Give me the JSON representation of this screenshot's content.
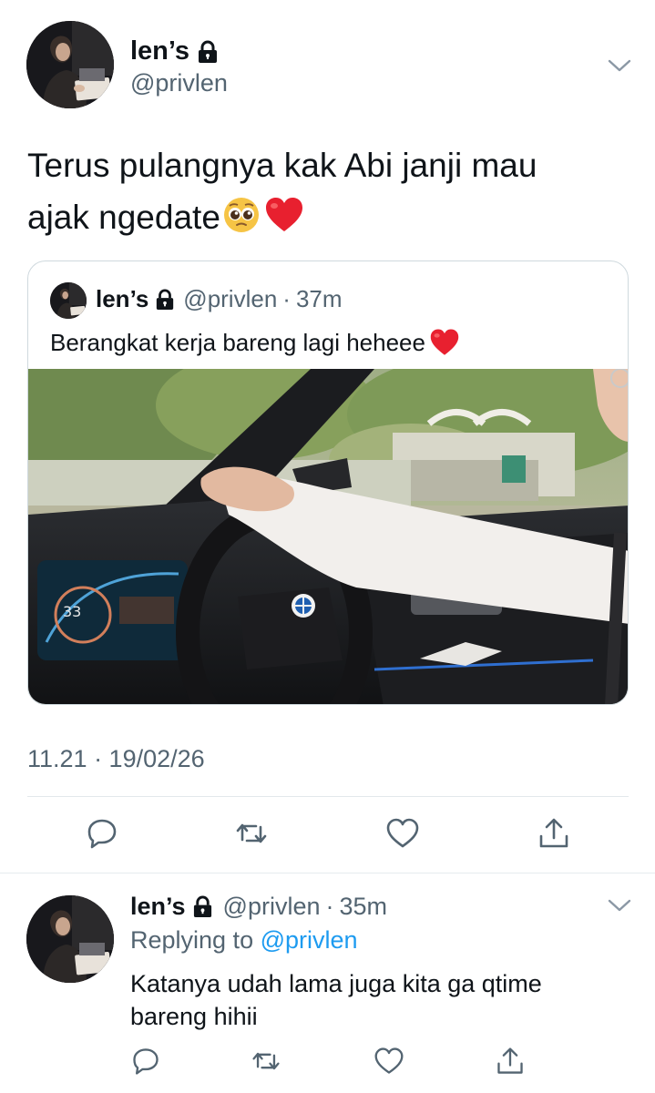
{
  "tweet": {
    "author_name": "len’s",
    "author_handle": "@privlen",
    "text_line1": "Terus pulangnya kak Abi janji mau",
    "text_line2": "ajak ngedate",
    "quoted": {
      "author_name": "len’s",
      "author_handle": "@privlen",
      "separator": "·",
      "time_ago": "37m",
      "text": "Berangkat kerja bareng lagi heheee"
    },
    "timestamp": "11.21 · 19/02/26"
  },
  "reply": {
    "author_name": "len’s",
    "author_handle": "@privlen",
    "separator": "·",
    "time_ago": "35m",
    "replying_prefix": "Replying to",
    "replying_to": "@privlen",
    "text_line1": "Katanya udah lama juga kita ga qtime",
    "text_line2": "bareng hihii"
  },
  "icons": {
    "lock": "lock-icon",
    "more": "chevron-down-icon",
    "reply": "reply-icon",
    "retweet": "retweet-icon",
    "like": "heart-icon",
    "share": "share-icon",
    "emoji_pleading": "pleading-face-emoji",
    "emoji_heart": "red-heart-emoji"
  },
  "colors": {
    "text": "#0f1419",
    "secondary": "#536471",
    "link": "#1d9bf0",
    "border": "#cfd9de",
    "heart": "#e0245e"
  }
}
